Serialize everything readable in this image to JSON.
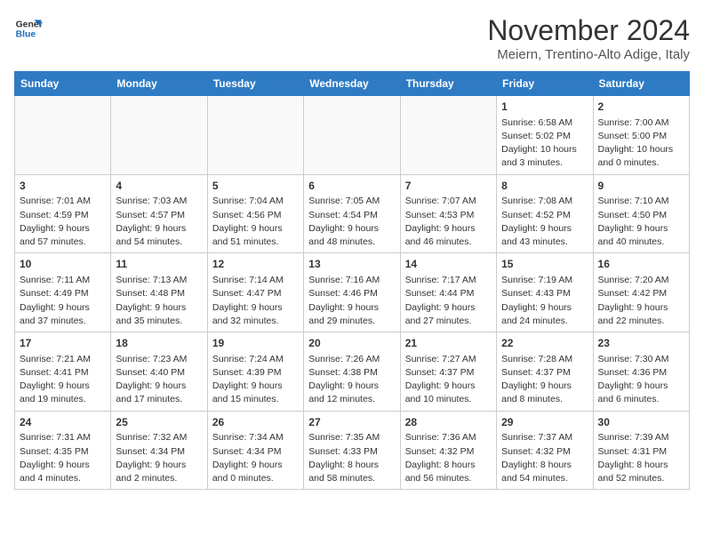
{
  "header": {
    "logo_line1": "General",
    "logo_line2": "Blue",
    "month_year": "November 2024",
    "location": "Meiern, Trentino-Alto Adige, Italy"
  },
  "weekdays": [
    "Sunday",
    "Monday",
    "Tuesday",
    "Wednesday",
    "Thursday",
    "Friday",
    "Saturday"
  ],
  "weeks": [
    [
      {
        "day": "",
        "info": ""
      },
      {
        "day": "",
        "info": ""
      },
      {
        "day": "",
        "info": ""
      },
      {
        "day": "",
        "info": ""
      },
      {
        "day": "",
        "info": ""
      },
      {
        "day": "1",
        "info": "Sunrise: 6:58 AM\nSunset: 5:02 PM\nDaylight: 10 hours\nand 3 minutes."
      },
      {
        "day": "2",
        "info": "Sunrise: 7:00 AM\nSunset: 5:00 PM\nDaylight: 10 hours\nand 0 minutes."
      }
    ],
    [
      {
        "day": "3",
        "info": "Sunrise: 7:01 AM\nSunset: 4:59 PM\nDaylight: 9 hours\nand 57 minutes."
      },
      {
        "day": "4",
        "info": "Sunrise: 7:03 AM\nSunset: 4:57 PM\nDaylight: 9 hours\nand 54 minutes."
      },
      {
        "day": "5",
        "info": "Sunrise: 7:04 AM\nSunset: 4:56 PM\nDaylight: 9 hours\nand 51 minutes."
      },
      {
        "day": "6",
        "info": "Sunrise: 7:05 AM\nSunset: 4:54 PM\nDaylight: 9 hours\nand 48 minutes."
      },
      {
        "day": "7",
        "info": "Sunrise: 7:07 AM\nSunset: 4:53 PM\nDaylight: 9 hours\nand 46 minutes."
      },
      {
        "day": "8",
        "info": "Sunrise: 7:08 AM\nSunset: 4:52 PM\nDaylight: 9 hours\nand 43 minutes."
      },
      {
        "day": "9",
        "info": "Sunrise: 7:10 AM\nSunset: 4:50 PM\nDaylight: 9 hours\nand 40 minutes."
      }
    ],
    [
      {
        "day": "10",
        "info": "Sunrise: 7:11 AM\nSunset: 4:49 PM\nDaylight: 9 hours\nand 37 minutes."
      },
      {
        "day": "11",
        "info": "Sunrise: 7:13 AM\nSunset: 4:48 PM\nDaylight: 9 hours\nand 35 minutes."
      },
      {
        "day": "12",
        "info": "Sunrise: 7:14 AM\nSunset: 4:47 PM\nDaylight: 9 hours\nand 32 minutes."
      },
      {
        "day": "13",
        "info": "Sunrise: 7:16 AM\nSunset: 4:46 PM\nDaylight: 9 hours\nand 29 minutes."
      },
      {
        "day": "14",
        "info": "Sunrise: 7:17 AM\nSunset: 4:44 PM\nDaylight: 9 hours\nand 27 minutes."
      },
      {
        "day": "15",
        "info": "Sunrise: 7:19 AM\nSunset: 4:43 PM\nDaylight: 9 hours\nand 24 minutes."
      },
      {
        "day": "16",
        "info": "Sunrise: 7:20 AM\nSunset: 4:42 PM\nDaylight: 9 hours\nand 22 minutes."
      }
    ],
    [
      {
        "day": "17",
        "info": "Sunrise: 7:21 AM\nSunset: 4:41 PM\nDaylight: 9 hours\nand 19 minutes."
      },
      {
        "day": "18",
        "info": "Sunrise: 7:23 AM\nSunset: 4:40 PM\nDaylight: 9 hours\nand 17 minutes."
      },
      {
        "day": "19",
        "info": "Sunrise: 7:24 AM\nSunset: 4:39 PM\nDaylight: 9 hours\nand 15 minutes."
      },
      {
        "day": "20",
        "info": "Sunrise: 7:26 AM\nSunset: 4:38 PM\nDaylight: 9 hours\nand 12 minutes."
      },
      {
        "day": "21",
        "info": "Sunrise: 7:27 AM\nSunset: 4:37 PM\nDaylight: 9 hours\nand 10 minutes."
      },
      {
        "day": "22",
        "info": "Sunrise: 7:28 AM\nSunset: 4:37 PM\nDaylight: 9 hours\nand 8 minutes."
      },
      {
        "day": "23",
        "info": "Sunrise: 7:30 AM\nSunset: 4:36 PM\nDaylight: 9 hours\nand 6 minutes."
      }
    ],
    [
      {
        "day": "24",
        "info": "Sunrise: 7:31 AM\nSunset: 4:35 PM\nDaylight: 9 hours\nand 4 minutes."
      },
      {
        "day": "25",
        "info": "Sunrise: 7:32 AM\nSunset: 4:34 PM\nDaylight: 9 hours\nand 2 minutes."
      },
      {
        "day": "26",
        "info": "Sunrise: 7:34 AM\nSunset: 4:34 PM\nDaylight: 9 hours\nand 0 minutes."
      },
      {
        "day": "27",
        "info": "Sunrise: 7:35 AM\nSunset: 4:33 PM\nDaylight: 8 hours\nand 58 minutes."
      },
      {
        "day": "28",
        "info": "Sunrise: 7:36 AM\nSunset: 4:32 PM\nDaylight: 8 hours\nand 56 minutes."
      },
      {
        "day": "29",
        "info": "Sunrise: 7:37 AM\nSunset: 4:32 PM\nDaylight: 8 hours\nand 54 minutes."
      },
      {
        "day": "30",
        "info": "Sunrise: 7:39 AM\nSunset: 4:31 PM\nDaylight: 8 hours\nand 52 minutes."
      }
    ]
  ]
}
